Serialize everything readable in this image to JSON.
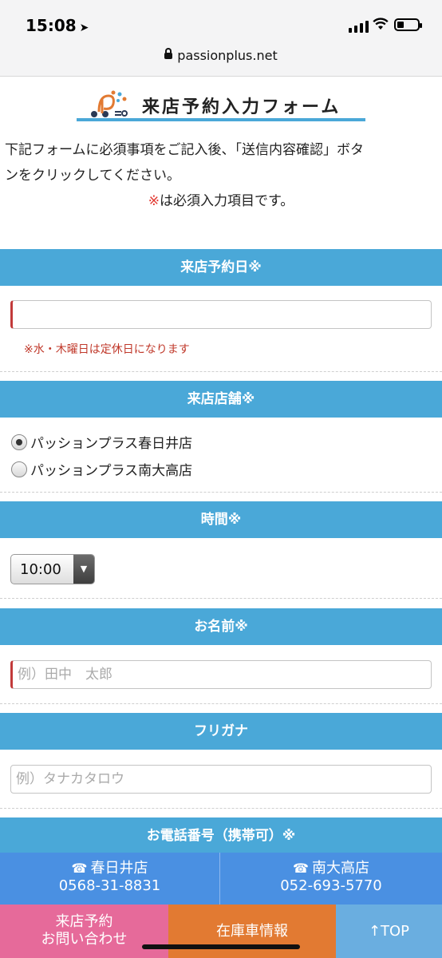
{
  "status_bar": {
    "time": "15:08",
    "url": "passionplus.net"
  },
  "header": {
    "title": "来店予約入力フォーム"
  },
  "intro": {
    "line1": "下記フォームに必須事項をご記入後、「送信内容確認」ボタ",
    "line2": "ンをクリックしてください。",
    "required_mark": "※",
    "required_text": "は必須入力項目です。"
  },
  "sections": {
    "date": {
      "label": "来店予約日※",
      "value": "",
      "note": "※水・木曜日は定休日になります"
    },
    "store": {
      "label": "来店店舗※",
      "options": [
        "パッションプラス春日井店",
        "パッションプラス南大高店"
      ],
      "selected_index": 0
    },
    "time": {
      "label": "時間※",
      "selected": "10:00"
    },
    "name": {
      "label": "お名前※",
      "placeholder": "例）田中　太郎"
    },
    "kana": {
      "label": "フリガナ",
      "placeholder": "例）タナカタロウ"
    },
    "phone": {
      "label": "お電話番号（携帯可）※"
    }
  },
  "shops": [
    {
      "name": "春日井店",
      "phone": "0568-31-8831"
    },
    {
      "name": "南大高店",
      "phone": "052-693-5770"
    }
  ],
  "bottom_nav": {
    "reserve_line1": "来店予約",
    "reserve_line2": "お問い合わせ",
    "stock": "在庫車情報",
    "top": "↑TOP"
  },
  "colors": {
    "section": "#4aa8d8",
    "shop_bar": "#4a90e2",
    "reserve": "#e66a9a",
    "stock": "#e27a32",
    "top": "#6aaee0"
  },
  "icons": [
    "navigation-arrow-icon",
    "signal-icon",
    "wifi-icon",
    "battery-icon",
    "lock-icon",
    "logo",
    "phone-icon",
    "select-arrow-icon"
  ]
}
